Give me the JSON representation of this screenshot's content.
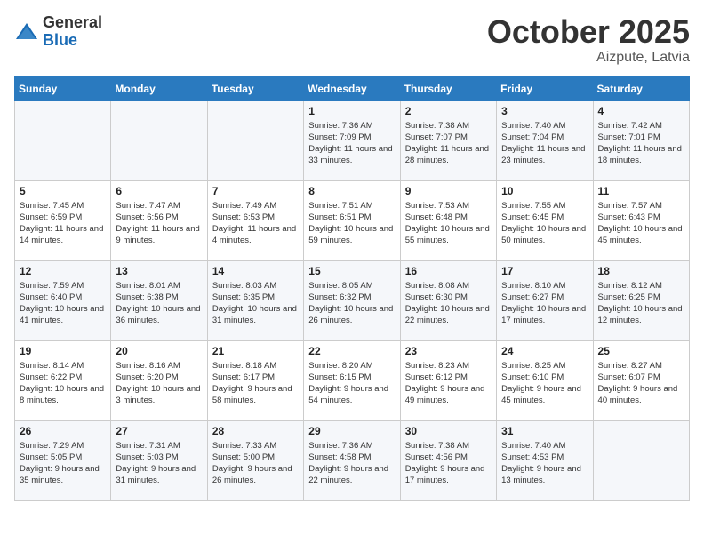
{
  "header": {
    "logo_general": "General",
    "logo_blue": "Blue",
    "month": "October 2025",
    "location": "Aizpute, Latvia"
  },
  "days_of_week": [
    "Sunday",
    "Monday",
    "Tuesday",
    "Wednesday",
    "Thursday",
    "Friday",
    "Saturday"
  ],
  "weeks": [
    [
      {
        "day": "",
        "sunrise": "",
        "sunset": "",
        "daylight": ""
      },
      {
        "day": "",
        "sunrise": "",
        "sunset": "",
        "daylight": ""
      },
      {
        "day": "",
        "sunrise": "",
        "sunset": "",
        "daylight": ""
      },
      {
        "day": "1",
        "sunrise": "Sunrise: 7:36 AM",
        "sunset": "Sunset: 7:09 PM",
        "daylight": "Daylight: 11 hours and 33 minutes."
      },
      {
        "day": "2",
        "sunrise": "Sunrise: 7:38 AM",
        "sunset": "Sunset: 7:07 PM",
        "daylight": "Daylight: 11 hours and 28 minutes."
      },
      {
        "day": "3",
        "sunrise": "Sunrise: 7:40 AM",
        "sunset": "Sunset: 7:04 PM",
        "daylight": "Daylight: 11 hours and 23 minutes."
      },
      {
        "day": "4",
        "sunrise": "Sunrise: 7:42 AM",
        "sunset": "Sunset: 7:01 PM",
        "daylight": "Daylight: 11 hours and 18 minutes."
      }
    ],
    [
      {
        "day": "5",
        "sunrise": "Sunrise: 7:45 AM",
        "sunset": "Sunset: 6:59 PM",
        "daylight": "Daylight: 11 hours and 14 minutes."
      },
      {
        "day": "6",
        "sunrise": "Sunrise: 7:47 AM",
        "sunset": "Sunset: 6:56 PM",
        "daylight": "Daylight: 11 hours and 9 minutes."
      },
      {
        "day": "7",
        "sunrise": "Sunrise: 7:49 AM",
        "sunset": "Sunset: 6:53 PM",
        "daylight": "Daylight: 11 hours and 4 minutes."
      },
      {
        "day": "8",
        "sunrise": "Sunrise: 7:51 AM",
        "sunset": "Sunset: 6:51 PM",
        "daylight": "Daylight: 10 hours and 59 minutes."
      },
      {
        "day": "9",
        "sunrise": "Sunrise: 7:53 AM",
        "sunset": "Sunset: 6:48 PM",
        "daylight": "Daylight: 10 hours and 55 minutes."
      },
      {
        "day": "10",
        "sunrise": "Sunrise: 7:55 AM",
        "sunset": "Sunset: 6:45 PM",
        "daylight": "Daylight: 10 hours and 50 minutes."
      },
      {
        "day": "11",
        "sunrise": "Sunrise: 7:57 AM",
        "sunset": "Sunset: 6:43 PM",
        "daylight": "Daylight: 10 hours and 45 minutes."
      }
    ],
    [
      {
        "day": "12",
        "sunrise": "Sunrise: 7:59 AM",
        "sunset": "Sunset: 6:40 PM",
        "daylight": "Daylight: 10 hours and 41 minutes."
      },
      {
        "day": "13",
        "sunrise": "Sunrise: 8:01 AM",
        "sunset": "Sunset: 6:38 PM",
        "daylight": "Daylight: 10 hours and 36 minutes."
      },
      {
        "day": "14",
        "sunrise": "Sunrise: 8:03 AM",
        "sunset": "Sunset: 6:35 PM",
        "daylight": "Daylight: 10 hours and 31 minutes."
      },
      {
        "day": "15",
        "sunrise": "Sunrise: 8:05 AM",
        "sunset": "Sunset: 6:32 PM",
        "daylight": "Daylight: 10 hours and 26 minutes."
      },
      {
        "day": "16",
        "sunrise": "Sunrise: 8:08 AM",
        "sunset": "Sunset: 6:30 PM",
        "daylight": "Daylight: 10 hours and 22 minutes."
      },
      {
        "day": "17",
        "sunrise": "Sunrise: 8:10 AM",
        "sunset": "Sunset: 6:27 PM",
        "daylight": "Daylight: 10 hours and 17 minutes."
      },
      {
        "day": "18",
        "sunrise": "Sunrise: 8:12 AM",
        "sunset": "Sunset: 6:25 PM",
        "daylight": "Daylight: 10 hours and 12 minutes."
      }
    ],
    [
      {
        "day": "19",
        "sunrise": "Sunrise: 8:14 AM",
        "sunset": "Sunset: 6:22 PM",
        "daylight": "Daylight: 10 hours and 8 minutes."
      },
      {
        "day": "20",
        "sunrise": "Sunrise: 8:16 AM",
        "sunset": "Sunset: 6:20 PM",
        "daylight": "Daylight: 10 hours and 3 minutes."
      },
      {
        "day": "21",
        "sunrise": "Sunrise: 8:18 AM",
        "sunset": "Sunset: 6:17 PM",
        "daylight": "Daylight: 9 hours and 58 minutes."
      },
      {
        "day": "22",
        "sunrise": "Sunrise: 8:20 AM",
        "sunset": "Sunset: 6:15 PM",
        "daylight": "Daylight: 9 hours and 54 minutes."
      },
      {
        "day": "23",
        "sunrise": "Sunrise: 8:23 AM",
        "sunset": "Sunset: 6:12 PM",
        "daylight": "Daylight: 9 hours and 49 minutes."
      },
      {
        "day": "24",
        "sunrise": "Sunrise: 8:25 AM",
        "sunset": "Sunset: 6:10 PM",
        "daylight": "Daylight: 9 hours and 45 minutes."
      },
      {
        "day": "25",
        "sunrise": "Sunrise: 8:27 AM",
        "sunset": "Sunset: 6:07 PM",
        "daylight": "Daylight: 9 hours and 40 minutes."
      }
    ],
    [
      {
        "day": "26",
        "sunrise": "Sunrise: 7:29 AM",
        "sunset": "Sunset: 5:05 PM",
        "daylight": "Daylight: 9 hours and 35 minutes."
      },
      {
        "day": "27",
        "sunrise": "Sunrise: 7:31 AM",
        "sunset": "Sunset: 5:03 PM",
        "daylight": "Daylight: 9 hours and 31 minutes."
      },
      {
        "day": "28",
        "sunrise": "Sunrise: 7:33 AM",
        "sunset": "Sunset: 5:00 PM",
        "daylight": "Daylight: 9 hours and 26 minutes."
      },
      {
        "day": "29",
        "sunrise": "Sunrise: 7:36 AM",
        "sunset": "Sunset: 4:58 PM",
        "daylight": "Daylight: 9 hours and 22 minutes."
      },
      {
        "day": "30",
        "sunrise": "Sunrise: 7:38 AM",
        "sunset": "Sunset: 4:56 PM",
        "daylight": "Daylight: 9 hours and 17 minutes."
      },
      {
        "day": "31",
        "sunrise": "Sunrise: 7:40 AM",
        "sunset": "Sunset: 4:53 PM",
        "daylight": "Daylight: 9 hours and 13 minutes."
      },
      {
        "day": "",
        "sunrise": "",
        "sunset": "",
        "daylight": ""
      }
    ]
  ]
}
